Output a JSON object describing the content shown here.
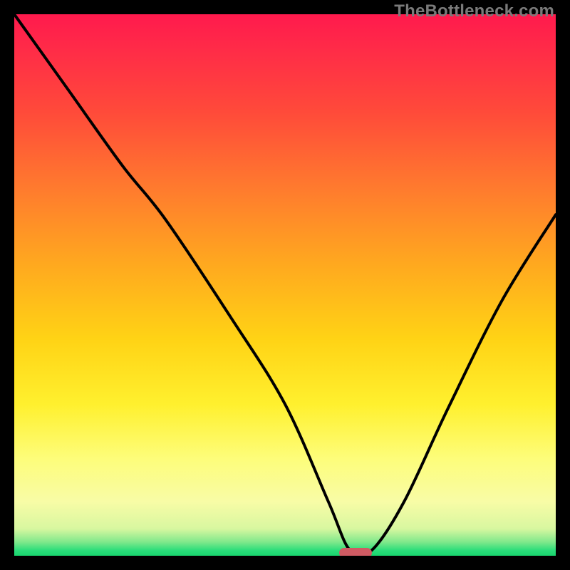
{
  "watermark": {
    "text": "TheBottleneck.com"
  },
  "chart_data": {
    "type": "line",
    "title": "",
    "xlabel": "",
    "ylabel": "",
    "xlim": [
      0,
      100
    ],
    "ylim": [
      0,
      100
    ],
    "grid": false,
    "legend": false,
    "series": [
      {
        "name": "bottleneck-curve",
        "x": [
          0,
          10,
          20,
          28,
          40,
          50,
          58,
          62,
          66,
          72,
          80,
          90,
          100
        ],
        "values": [
          100,
          86,
          72,
          62,
          44,
          28,
          10,
          1,
          1,
          10,
          27,
          47,
          63
        ]
      }
    ],
    "marker": {
      "x_start": 60,
      "x_end": 66,
      "y": 0.5,
      "color": "#cf5b63"
    },
    "gradient_stops": [
      {
        "pos": 0,
        "color": "#ff1a4d"
      },
      {
        "pos": 0.32,
        "color": "#ff7a2e"
      },
      {
        "pos": 0.6,
        "color": "#ffd315"
      },
      {
        "pos": 0.9,
        "color": "#f8fca6"
      },
      {
        "pos": 0.99,
        "color": "#2bdd7a"
      },
      {
        "pos": 1.0,
        "color": "#18d66e"
      }
    ]
  }
}
